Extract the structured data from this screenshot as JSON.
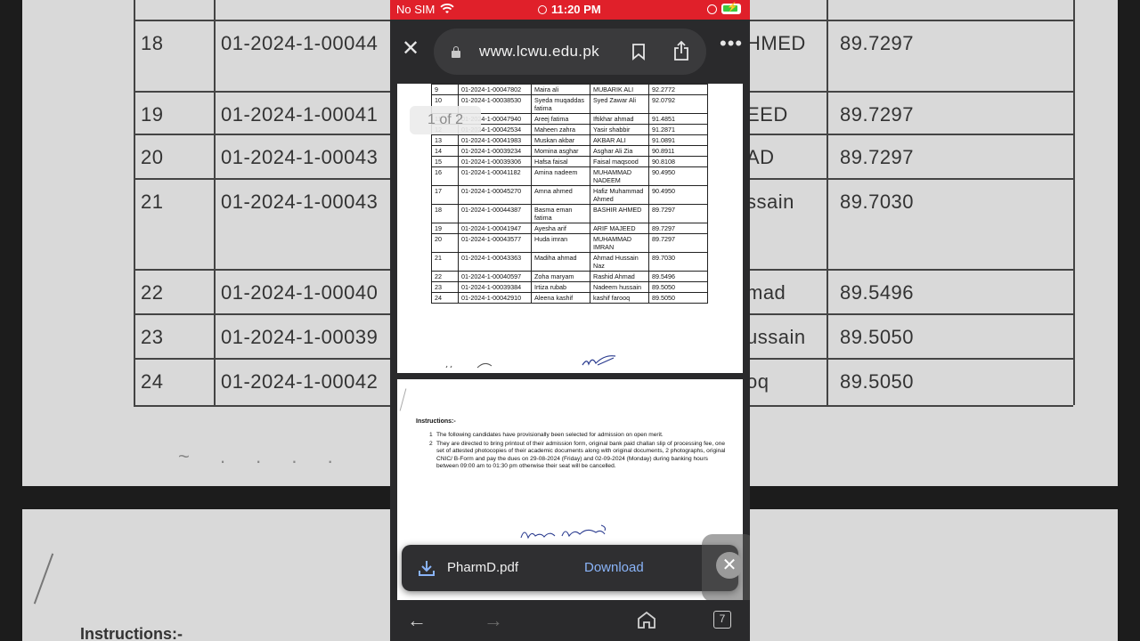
{
  "status_bar": {
    "carrier": "No SIM",
    "time": "11:20 PM"
  },
  "browser": {
    "url": "www.lcwu.edu.pk"
  },
  "pdf": {
    "page_indicator": "1 of 2",
    "rows": [
      {
        "sr": "9",
        "id": "01-2024-1-00047802",
        "name": "Maira ali",
        "father": "MUBARIK ALI",
        "score": "92.2772"
      },
      {
        "sr": "10",
        "id": "01-2024-1-00038530",
        "name": "Syeda muqaddas fatima",
        "father": "Syed Zawar Ali",
        "score": "92.0792"
      },
      {
        "sr": "11",
        "id": "01-2024-1-00047940",
        "name": "Areej fatima",
        "father": "Iftikhar ahmad",
        "score": "91.4851"
      },
      {
        "sr": "12",
        "id": "01-2024-1-00042534",
        "name": "Maheen zahra",
        "father": "Yasir shabbir",
        "score": "91.2871"
      },
      {
        "sr": "13",
        "id": "01-2024-1-00041983",
        "name": "Muskan akbar",
        "father": "AKBAR ALI",
        "score": "91.0891"
      },
      {
        "sr": "14",
        "id": "01-2024-1-00039234",
        "name": "Momina asghar",
        "father": "Asghar Ali Zia",
        "score": "90.8911"
      },
      {
        "sr": "15",
        "id": "01-2024-1-00039306",
        "name": "Hafsa faisal",
        "father": "Faisal maqsood",
        "score": "90.8108"
      },
      {
        "sr": "16",
        "id": "01-2024-1-00041182",
        "name": "Amina nadeem",
        "father": "MUHAMMAD NADEEM",
        "score": "90.4950"
      },
      {
        "sr": "17",
        "id": "01-2024-1-00045270",
        "name": "Amna ahmed",
        "father": "Hafiz Muhammad Ahmed",
        "score": "90.4950"
      },
      {
        "sr": "18",
        "id": "01-2024-1-00044387",
        "name": "Basma eman fatima",
        "father": "BASHIR AHMED",
        "score": "89.7297"
      },
      {
        "sr": "19",
        "id": "01-2024-1-00041947",
        "name": "Ayesha arif",
        "father": "ARIF MAJEED",
        "score": "89.7297"
      },
      {
        "sr": "20",
        "id": "01-2024-1-00043577",
        "name": "Huda imran",
        "father": "MUHAMMAD IMRAN",
        "score": "89.7297"
      },
      {
        "sr": "21",
        "id": "01-2024-1-00043363",
        "name": "Madiha ahmad",
        "father": "Ahmad Hussain Naz",
        "score": "89.7030"
      },
      {
        "sr": "22",
        "id": "01-2024-1-00040597",
        "name": "Zoha maryam",
        "father": "Rashid Ahmad",
        "score": "89.5496"
      },
      {
        "sr": "23",
        "id": "01-2024-1-00039384",
        "name": "Irtiza rubab",
        "father": "Nadeem hussain",
        "score": "89.5050"
      },
      {
        "sr": "24",
        "id": "01-2024-1-00042910",
        "name": "Aleena kashif",
        "father": "kashif farooq",
        "score": "89.5050"
      }
    ],
    "instructions_title": "Instructions:-",
    "instructions": [
      {
        "num": "1",
        "text": "The following candidates have provisionally been selected for admission on open merit."
      },
      {
        "num": "2",
        "text": "They are directed to bring printout of their admission form, original bank paid challan slip of processing fee, one set of attested photocopies of their academic documents along with original documents, 2 photographs, original CNIC/ B-Form and pay the dues on 29-08-2024 (Friday) and 02-09-2024 (Monday) during banking hours between 09:00 am to 01:30 pm otherwise their seat will be cancelled."
      }
    ]
  },
  "background": {
    "rows": [
      {
        "sr": "18",
        "id": "01-2024-1-00044",
        "father": "HMED",
        "score": "89.7297"
      },
      {
        "sr": "19",
        "id": "01-2024-1-00041",
        "father": "EED",
        "score": "89.7297"
      },
      {
        "sr": "20",
        "id": "01-2024-1-00043",
        "father": "AD",
        "score": "89.7297"
      },
      {
        "sr": "21",
        "id": "01-2024-1-00043",
        "father": "ssain",
        "score": "89.7030"
      },
      {
        "sr": "22",
        "id": "01-2024-1-00040",
        "father": "mad",
        "score": "89.5496"
      },
      {
        "sr": "23",
        "id": "01-2024-1-00039",
        "father": "ussain",
        "score": "89.5050"
      },
      {
        "sr": "24",
        "id": "01-2024-1-00042",
        "father": "oq",
        "score": "89.5050"
      }
    ],
    "instructions_fragment": "Instructions:-"
  },
  "download_bar": {
    "filename": "PharmD.pdf",
    "action_label": "Download"
  },
  "navbar": {
    "tab_count": "7"
  },
  "colors": {
    "status_bar": "#e0202a",
    "link_blue": "#8ab4f8",
    "chrome_dark": "#2a2a2c"
  }
}
